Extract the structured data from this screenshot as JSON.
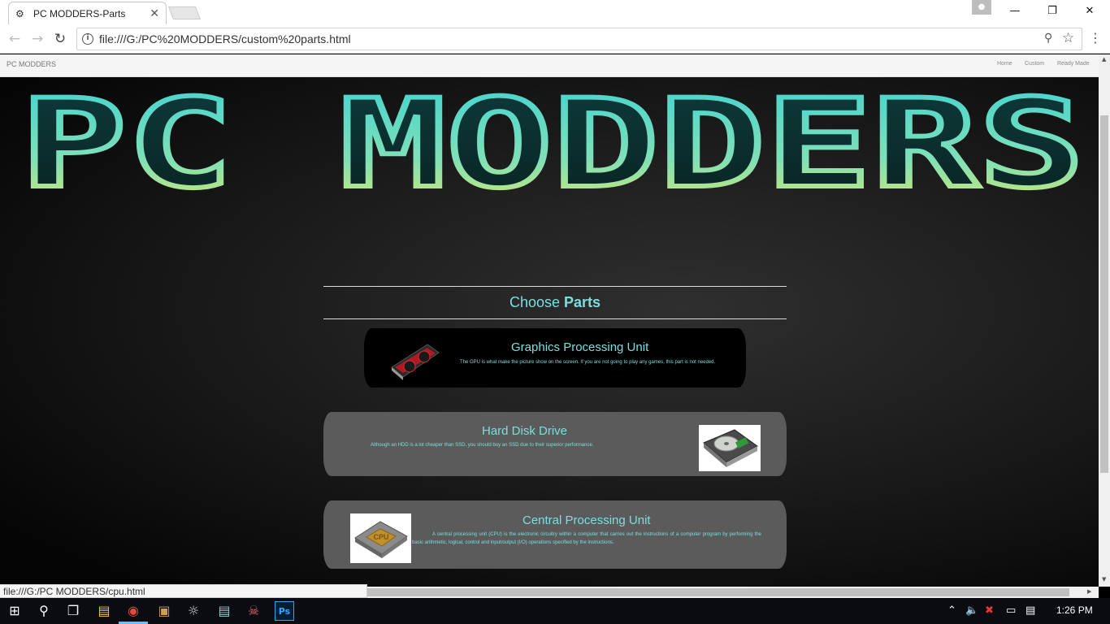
{
  "browser": {
    "tab_title": "PC MODDERS-Parts",
    "url": "file:///G:/PC%20MODDERS/custom%20parts.html",
    "status_url": "file:///G:/PC MODDERS/cpu.html"
  },
  "site": {
    "brand": "PC MODDERS",
    "nav": [
      "Home",
      "Custom",
      "Ready Made"
    ],
    "logo_text": "PC MODDERS"
  },
  "section": {
    "heading_light": "Choose ",
    "heading_bold": "Parts"
  },
  "parts": [
    {
      "title": "Graphics Processing Unit",
      "description": "The GPU is what make the picture show on the screen. If you are not going to play any games, this part is not needed."
    },
    {
      "title": "Hard Disk Drive",
      "description": "Although an HDD is a lot cheaper than SSD, you should buy an SSD due to their superior performance."
    },
    {
      "title": "Central Processing Unit",
      "description": "A central processing unit (CPU) is the electronic circuitry within a computer that carries out the instructions of a computer program by performing the basic arithmetic, logical, control and input/output (I/O) operations specified by the instructions.",
      "chip_label": "CPU"
    }
  ],
  "taskbar": {
    "time": "1:26 PM"
  },
  "colors": {
    "accent": "#7ddede",
    "card_dark": "#000000",
    "card_grey": "#5b5b5b"
  }
}
